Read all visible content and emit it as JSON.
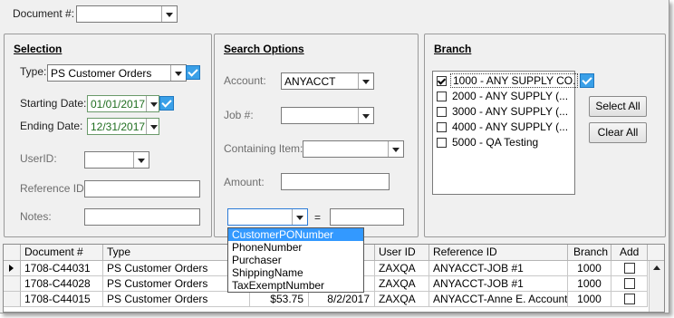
{
  "document": {
    "label": "Document #:",
    "value": ""
  },
  "selection": {
    "title": "Selection",
    "type_label": "Type:",
    "type_value": "PS Customer Orders",
    "starting_date_label": "Starting Date:",
    "starting_date": "01/01/2017",
    "ending_date_label": "Ending Date:",
    "ending_date": "12/31/2017",
    "userid_label": "UserID:",
    "userid_value": "",
    "reference_id_label": "Reference ID:",
    "notes_label": "Notes:"
  },
  "search_options": {
    "title": "Search Options",
    "account_label": "Account:",
    "account_value": "ANYACCT",
    "job_label": "Job #:",
    "job_value": "",
    "containing_item_label": "Containing Item:",
    "amount_label": "Amount:",
    "field_equals": "=",
    "field_dropdown": {
      "options": [
        "CustomerPONumber",
        "PhoneNumber",
        "Purchaser",
        "ShippingName",
        "TaxExemptNumber"
      ],
      "highlighted": "CustomerPONumber"
    }
  },
  "branch": {
    "title": "Branch",
    "items": [
      {
        "label": "1000 - ANY SUPPLY CO.",
        "checked": true
      },
      {
        "label": "2000 - ANY SUPPLY (...",
        "checked": false
      },
      {
        "label": "3000 - ANY SUPPLY (...",
        "checked": false
      },
      {
        "label": "4000 - ANY SUPPLY (...",
        "checked": false
      },
      {
        "label": "5000 - QA Testing",
        "checked": false
      }
    ],
    "select_all_label": "Select All",
    "clear_all_label": "Clear All"
  },
  "grid": {
    "columns": [
      "Document #",
      "Type",
      "",
      "",
      "User ID",
      "Reference ID",
      "Branch",
      "Add"
    ],
    "rows": [
      {
        "document": "1708-C44031",
        "type": "PS Customer Orders",
        "amount": "",
        "date": "",
        "user": "ZAXQA",
        "reference": "ANYACCT-JOB #1",
        "branch": "1000",
        "add": false
      },
      {
        "document": "1708-C44028",
        "type": "PS Customer Orders",
        "amount": "",
        "date": "",
        "user": "ZAXQA",
        "reference": "ANYACCT-JOB #1",
        "branch": "1000",
        "add": false
      },
      {
        "document": "1708-C44015",
        "type": "PS Customer Orders",
        "amount": "$53.75",
        "date": "8/2/2017",
        "user": "ZAXQA",
        "reference": "ANYACCT-Anne E. Account",
        "branch": "1000",
        "add": false
      }
    ]
  },
  "colors": {
    "accent_check": "#3aa0e8",
    "highlight": "#3399ff",
    "date_text": "#1f6e1f"
  }
}
